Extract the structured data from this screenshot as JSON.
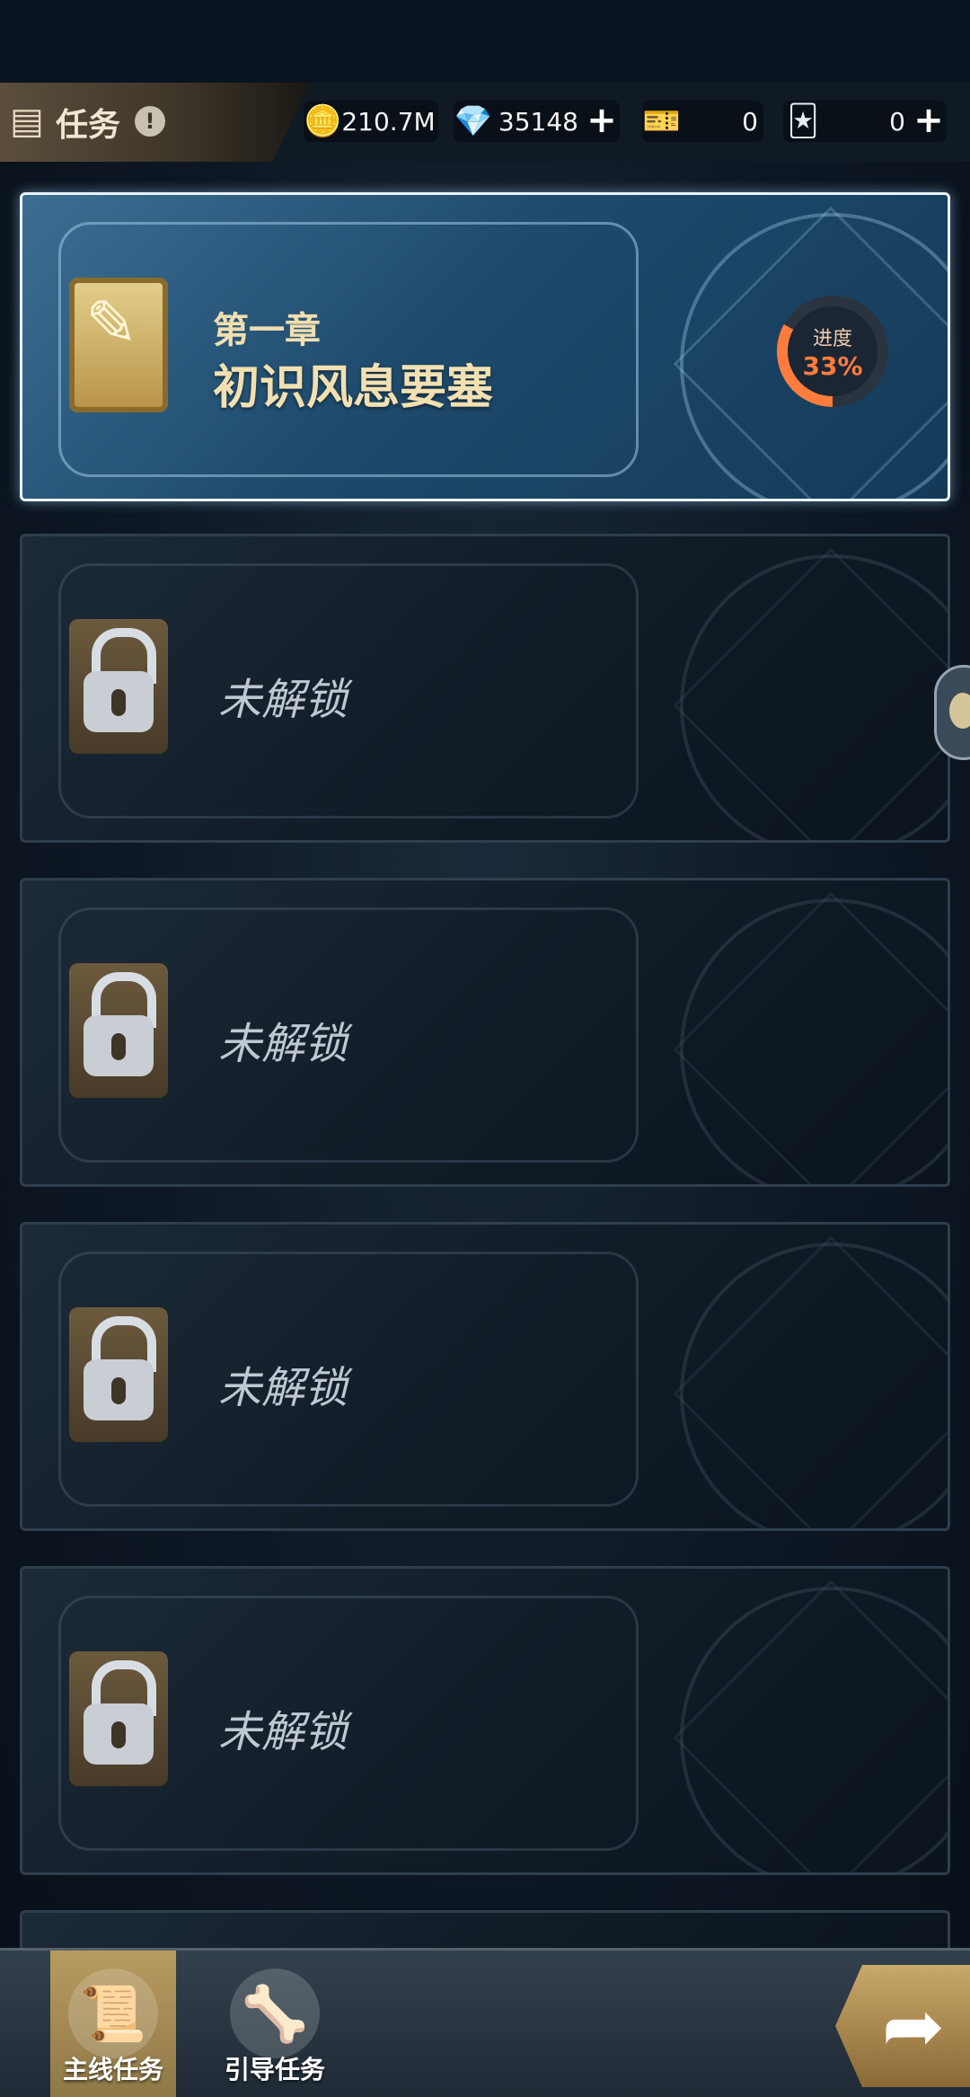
{
  "header": {
    "title": "任务",
    "info_icon": "!",
    "currencies": [
      {
        "name": "gold-coin-icon",
        "glyph": "🪙",
        "value": "210.7M",
        "has_plus": false
      },
      {
        "name": "diamond-icon",
        "glyph": "💎",
        "value": "35148",
        "has_plus": true
      },
      {
        "name": "ticket-red-icon",
        "glyph": "🎫",
        "value": "0",
        "has_plus": false
      },
      {
        "name": "ticket-card-icon",
        "glyph": "🃏",
        "value": "0",
        "has_plus": true
      }
    ],
    "plus_glyph": "+"
  },
  "chapters": [
    {
      "state": "active",
      "chapter_label": "第一章",
      "chapter_name": "初识风息要塞",
      "progress_label": "进度",
      "progress_value": "33%",
      "progress_fraction": 0.33,
      "progress_color": "#ff7c3d"
    },
    {
      "state": "locked",
      "locked_text": "未解锁"
    },
    {
      "state": "locked",
      "locked_text": "未解锁"
    },
    {
      "state": "locked",
      "locked_text": "未解锁"
    },
    {
      "state": "locked",
      "locked_text": "未解锁"
    }
  ],
  "bottom_nav": {
    "tabs": [
      {
        "label": "主线任务",
        "icon": "scroll-icon",
        "selected": true
      },
      {
        "label": "引导任务",
        "icon": "bone-scroll-icon",
        "selected": false
      }
    ],
    "go_button_icon": "arrow-icon"
  }
}
